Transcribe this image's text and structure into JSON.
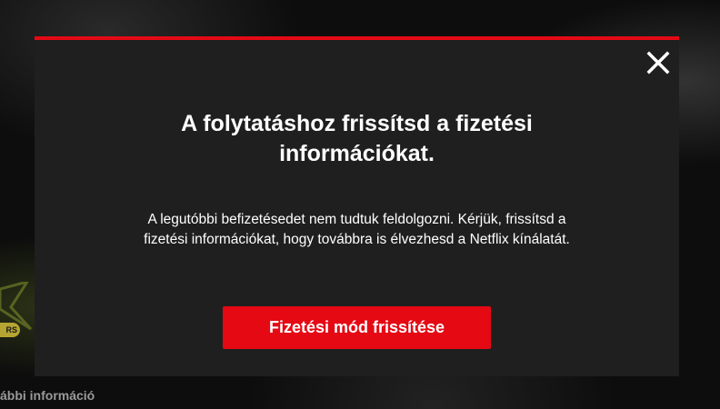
{
  "background": {
    "badge_text": "RS",
    "more_info_label": "ábbi információ"
  },
  "modal": {
    "close_icon": "close-icon",
    "title": "A folytatáshoz frissítsd a fizetési információkat.",
    "body": "A legutóbbi befizetésedet nem tudtuk feldolgozni. Kérjük, frissítsd a fizetési információkat, hogy továbbra is élvezhesd a Netflix kínálatát.",
    "cta_label": "Fizetési mód frissítése"
  },
  "colors": {
    "accent": "#e50914",
    "modal_background": "#1f1f1f",
    "page_background": "#0d0d0d",
    "text": "#ffffff"
  }
}
